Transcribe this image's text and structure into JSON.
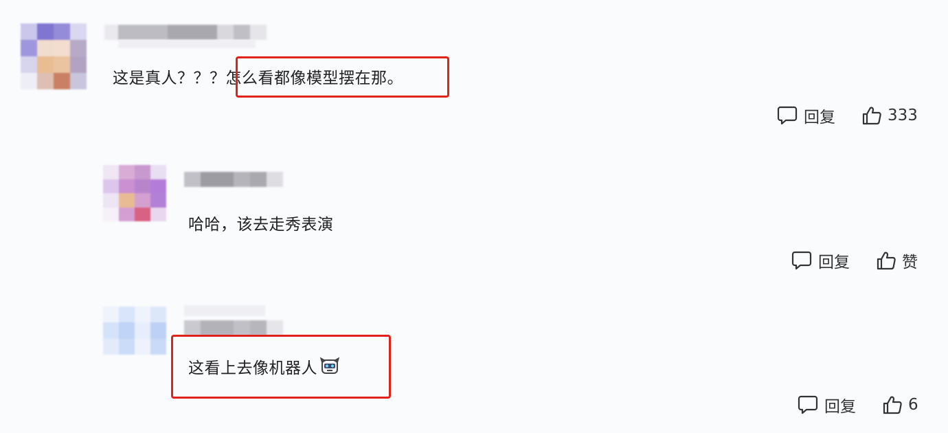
{
  "comments": [
    {
      "text_part1": "这是真人？？？",
      "text_part2": "怎么看都像模型摆在那。",
      "reply_label": "回复",
      "like_label": "333"
    },
    {
      "text": "哈哈，该去走秀表演",
      "reply_label": "回复",
      "like_label": "赞"
    },
    {
      "text": "这看上去像机器人",
      "emoji": "robot-icon",
      "reply_label": "回复",
      "like_label": "6"
    }
  ],
  "colors": {
    "highlight": "#e0221b",
    "text": "#222222",
    "background": "#fafbfd"
  }
}
